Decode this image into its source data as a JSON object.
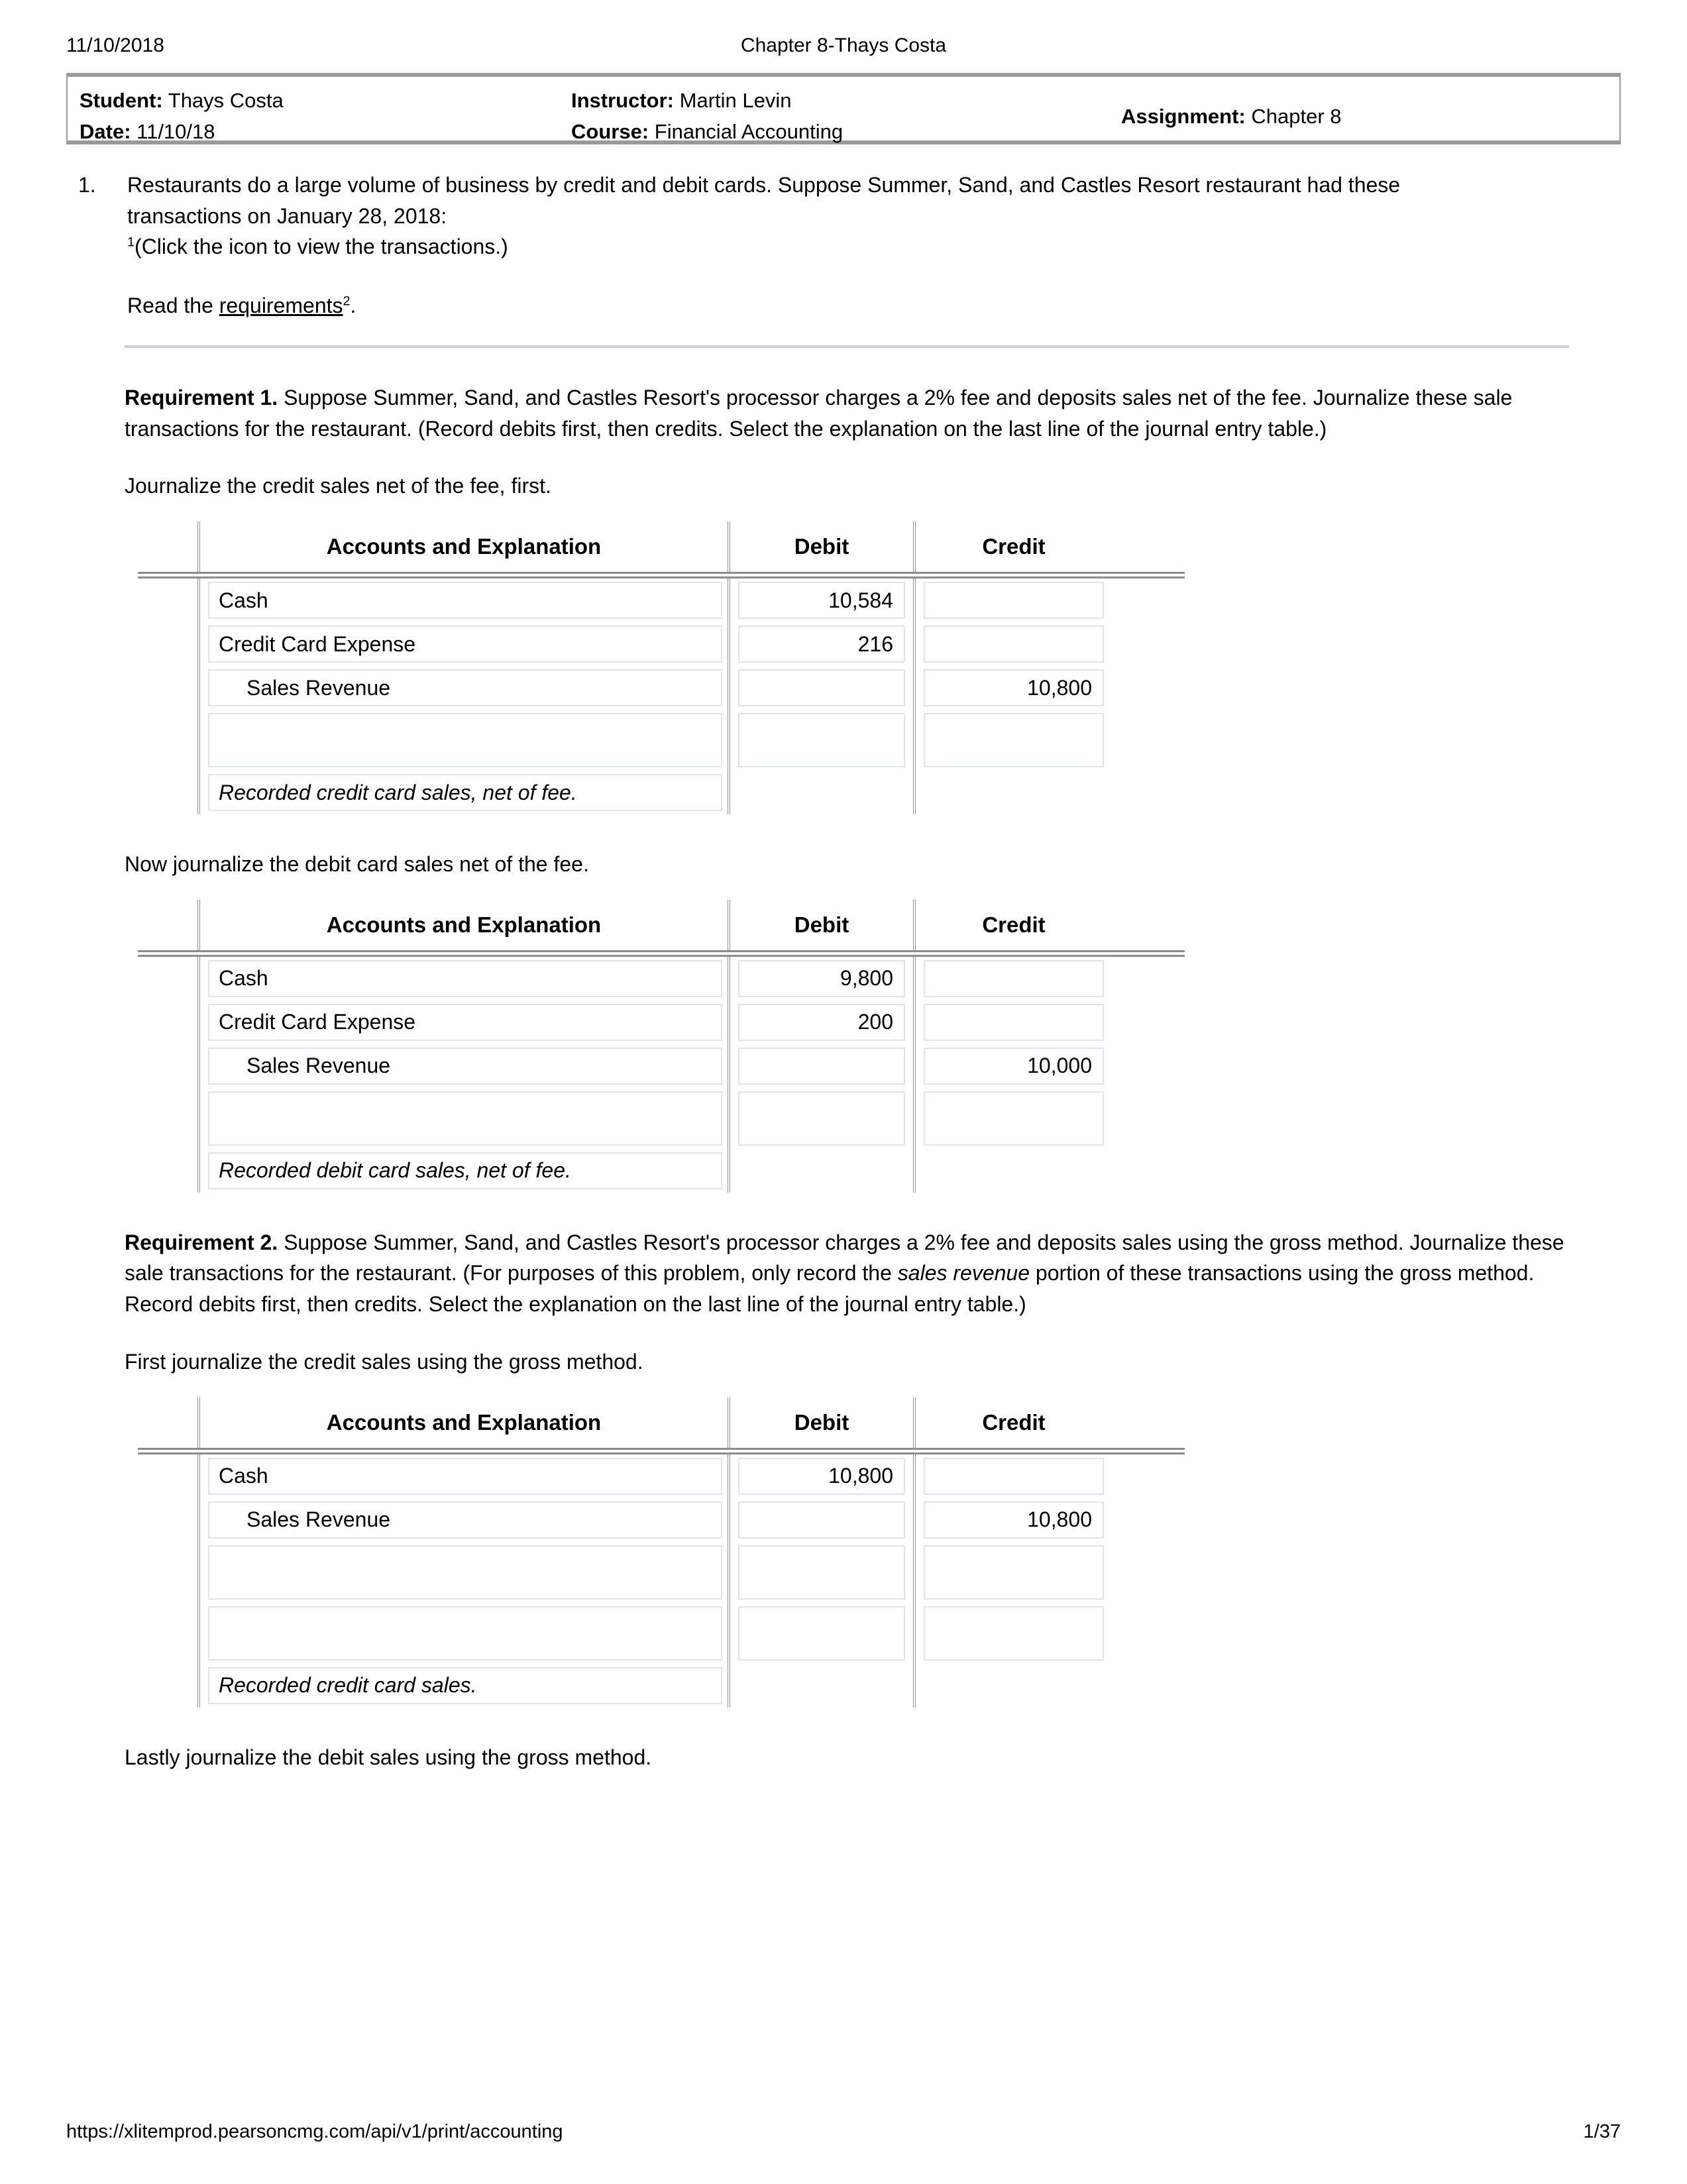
{
  "runhead": {
    "date": "11/10/2018",
    "title": "Chapter 8-Thays Costa"
  },
  "infobar": {
    "student_label": "Student:",
    "student_value": "Thays Costa",
    "date_label": "Date:",
    "date_value": "11/10/18",
    "instructor_label": "Instructor:",
    "instructor_value": "Martin Levin",
    "course_label": "Course:",
    "course_value": "Financial Accounting",
    "assignment_label": "Assignment:",
    "assignment_value": "Chapter 8"
  },
  "question": {
    "number": "1.",
    "stem": "Restaurants do a large volume of business by credit and debit cards. Suppose Summer, Sand, and Castles Resort restaurant had these transactions on January 28, 2018:",
    "click_note_sup": "1",
    "click_note": "(Click the icon to view the transactions.)",
    "read_prefix": "Read the ",
    "read_link": "requirements",
    "read_sup": "2",
    "read_suffix": "."
  },
  "requirement1": {
    "label": "Requirement 1.",
    "text": " Suppose Summer, Sand, and Castles Resort's processor charges a 2% fee and deposits sales net of the fee. Journalize these sale transactions for the restaurant. (Record debits first, then credits. Select the explanation on the last line of the journal entry table.)",
    "prompt_a": "Journalize the credit sales net of the fee, first.",
    "prompt_b": "Now journalize the debit card sales net of the fee."
  },
  "requirement2": {
    "label": "Requirement 2.",
    "text_part1": " Suppose Summer, Sand, and Castles Resort's processor charges a 2% fee and deposits sales using the gross method. Journalize these sale transactions for the restaurant. (For purposes of this problem, only record the ",
    "text_italic1": "sales revenue",
    "text_part2": " portion of these transactions using the gross method. Record debits first, then credits. Select the explanation on the last line of the journal entry table.)",
    "prompt_a": "First journalize the credit sales using the gross method.",
    "prompt_b": "Lastly journalize the debit sales using the gross method."
  },
  "table_headers": {
    "accounts": "Accounts and Explanation",
    "debit": "Debit",
    "credit": "Credit"
  },
  "tables": [
    {
      "id": "credit-sales-net-of-fee",
      "rows": [
        {
          "account": "Cash",
          "indent": false,
          "debit": "10,584",
          "credit": ""
        },
        {
          "account": "Credit Card Expense",
          "indent": false,
          "debit": "216",
          "credit": ""
        },
        {
          "account": "Sales Revenue",
          "indent": true,
          "debit": "",
          "credit": "10,800"
        },
        {
          "account": "",
          "indent": false,
          "debit": "",
          "credit": ""
        }
      ],
      "explanation": "Recorded credit card sales, net of fee."
    },
    {
      "id": "debit-sales-net-of-fee",
      "rows": [
        {
          "account": "Cash",
          "indent": false,
          "debit": "9,800",
          "credit": ""
        },
        {
          "account": "Credit Card Expense",
          "indent": false,
          "debit": "200",
          "credit": ""
        },
        {
          "account": "Sales Revenue",
          "indent": true,
          "debit": "",
          "credit": "10,000"
        },
        {
          "account": "",
          "indent": false,
          "debit": "",
          "credit": ""
        }
      ],
      "explanation": "Recorded debit card sales, net of fee."
    },
    {
      "id": "credit-sales-gross-method",
      "rows": [
        {
          "account": "Cash",
          "indent": false,
          "debit": "10,800",
          "credit": ""
        },
        {
          "account": "Sales Revenue",
          "indent": true,
          "debit": "",
          "credit": "10,800"
        },
        {
          "account": "",
          "indent": false,
          "debit": "",
          "credit": ""
        },
        {
          "account": "",
          "indent": false,
          "debit": "",
          "credit": ""
        }
      ],
      "explanation": "Recorded credit card sales."
    }
  ],
  "footer": {
    "url": "https://xlitemprod.pearsoncmg.com/api/v1/print/accounting",
    "page": "1/37"
  }
}
